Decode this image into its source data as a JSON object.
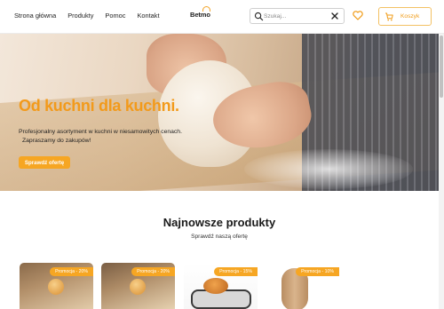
{
  "header": {
    "nav": [
      "Strona główna",
      "Produkty",
      "Pomoc",
      "Kontakt"
    ],
    "logo": "Betmo",
    "search": {
      "placeholder": "Szukaj...",
      "value": ""
    },
    "cart_label": "Koszyk"
  },
  "hero": {
    "title": "Od kuchni dla kuchni.",
    "text_line1": "Profesjonalny asortyment w kuchni w niesamowitych cenach.",
    "text_line2": "Zapraszamy do zakupów!",
    "button": "Sprawdź ofertę"
  },
  "products_section": {
    "title": "Najnowsze produkty",
    "subtitle": "Sprawdź naszą ofertę",
    "badges": [
      "Promocja - 20%",
      "Promocja - 20%",
      "Promocja - 15%",
      "Promocja - 10%"
    ]
  },
  "colors": {
    "accent": "#f6a623",
    "hero_title": "#f29a1b"
  },
  "icons": [
    "search-icon",
    "close-icon",
    "heart-icon",
    "cart-icon"
  ]
}
